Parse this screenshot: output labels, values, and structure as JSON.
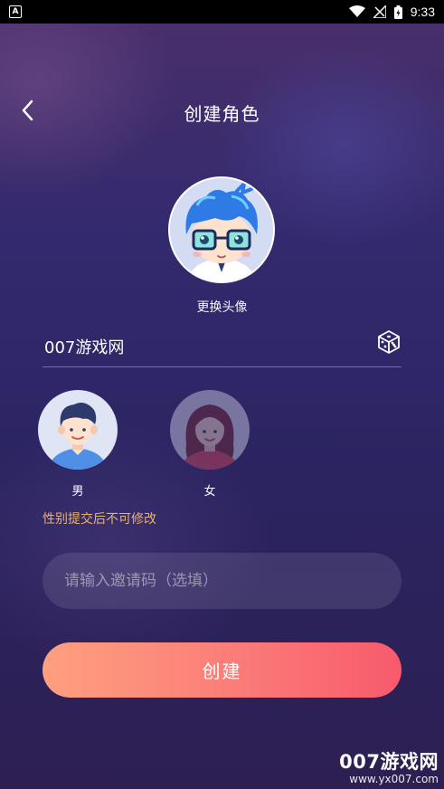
{
  "status_bar": {
    "app_icon_glyph": "A",
    "time": "9:33",
    "icons": [
      "wifi-icon",
      "signal-icon",
      "battery-icon"
    ]
  },
  "header": {
    "back_icon": "chevron-left-icon",
    "title": "创建角色"
  },
  "avatar": {
    "change_label": "更换头像"
  },
  "name_field": {
    "value": "007游戏网",
    "random_icon": "dice-icon"
  },
  "gender": {
    "options": [
      {
        "label": "男",
        "selected": true
      },
      {
        "label": "女",
        "selected": false
      }
    ],
    "hint": "性别提交后不可修改"
  },
  "invite": {
    "placeholder": "请输入邀请码（选填）",
    "value": ""
  },
  "create_button": {
    "label": "创建"
  },
  "watermark": {
    "logo": "007游戏网",
    "url": "www.yx007.com"
  },
  "colors": {
    "hint": "#e8b26a",
    "button_start": "#ffa07e",
    "button_end": "#f85a6c"
  }
}
